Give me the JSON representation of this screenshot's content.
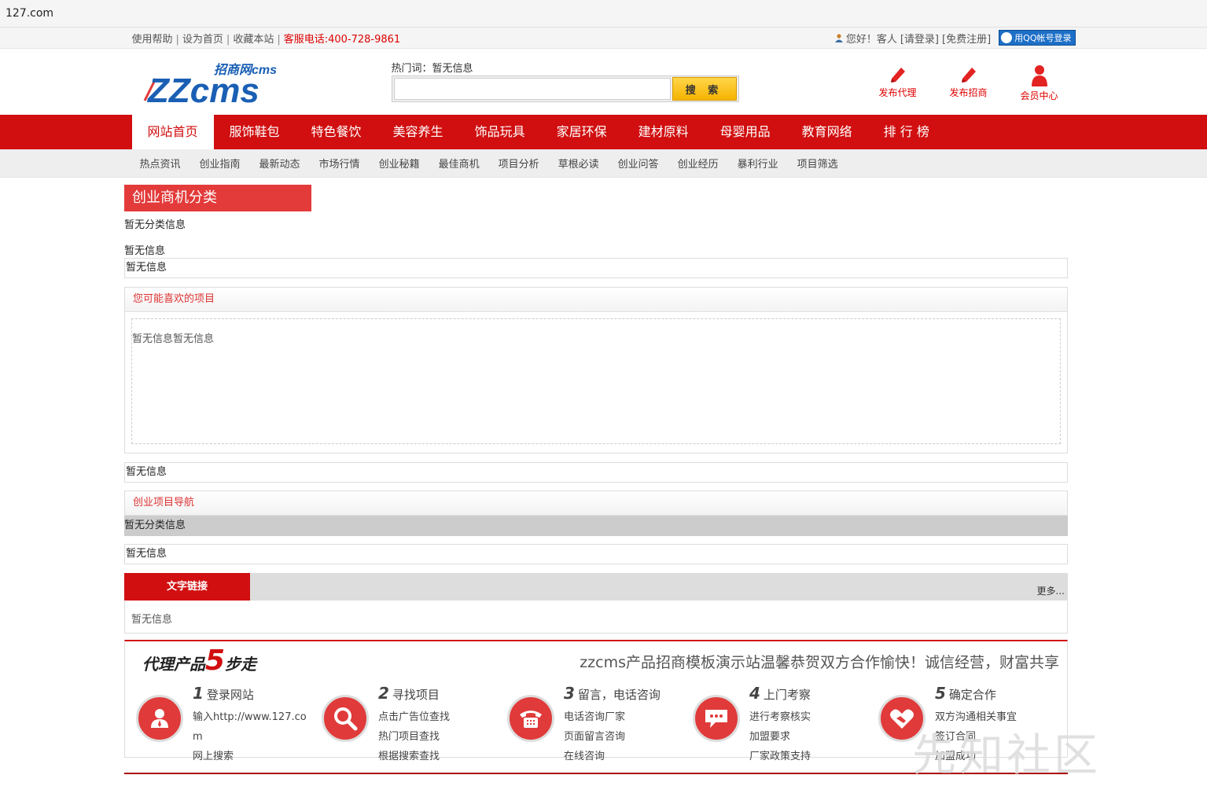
{
  "browser": {
    "url": "127.com"
  },
  "topbar": {
    "links": [
      "使用帮助",
      "设为首页",
      "收藏本站"
    ],
    "tel": "客服电话:400-728-9861",
    "greeting": "您好！客人",
    "login": "[请登录]",
    "register": "[免费注册]",
    "qq_login": "用QQ帐号登录"
  },
  "header": {
    "logo_top": "招商网cms",
    "logo_main": "ZZcms",
    "hot_words": "热门词：暂无信息",
    "search_button": "搜 索",
    "quick_links": [
      {
        "label": "发布代理",
        "icon": "pen-icon"
      },
      {
        "label": "发布招商",
        "icon": "pen-icon"
      },
      {
        "label": "会员中心",
        "icon": "user-icon"
      }
    ]
  },
  "nav": [
    "网站首页",
    "服饰鞋包",
    "特色餐饮",
    "美容养生",
    "饰品玩具",
    "家居环保",
    "建材原料",
    "母婴用品",
    "教育网络",
    "排 行 榜"
  ],
  "subnav": [
    "热点资讯",
    "创业指南",
    "最新动态",
    "市场行情",
    "创业秘籍",
    "最佳商机",
    "项目分析",
    "草根必读",
    "创业问答",
    "创业经历",
    "暴利行业",
    "项目筛选"
  ],
  "main": {
    "category_title": "创业商机分类",
    "no_category": "暂无分类信息",
    "no_info_1": "暂无信息",
    "no_info_2": "暂无信息",
    "like_title": "您可能喜欢的项目",
    "like_body": "暂无信息暂无信息",
    "no_info_3": "暂无信息",
    "nav_title": "创业项目导航",
    "nav_no_category": "暂无分类信息",
    "no_info_4": "暂无信息",
    "links_title": "文字链接",
    "links_more": "更多...",
    "links_body": "暂无信息"
  },
  "steps": {
    "title_a": "代理产品",
    "title_num": "5",
    "title_b": "步走",
    "slogan": "zzcms产品招商模板演示站温馨恭贺双方合作愉快！诚信经营，财富共享",
    "items": [
      {
        "n": "1",
        "title": "登录网站",
        "lines": [
          "输入http://www.127.co",
          "m",
          "网上搜索"
        ],
        "icon": "person-icon"
      },
      {
        "n": "2",
        "title": "寻找项目",
        "lines": [
          "点击广告位查找",
          "热门项目查找",
          "根据搜索查找"
        ],
        "icon": "magnifier-icon"
      },
      {
        "n": "3",
        "title": "留言，电话咨询",
        "lines": [
          "电话咨询厂家",
          "页面留言咨询",
          "在线咨询"
        ],
        "icon": "phone-icon"
      },
      {
        "n": "4",
        "title": "上门考察",
        "lines": [
          "进行考察核实",
          "加盟要求",
          "厂家政策支持"
        ],
        "icon": "chat-icon"
      },
      {
        "n": "5",
        "title": "确定合作",
        "lines": [
          "双方沟通相关事宜",
          "签订合同",
          "加盟成功"
        ],
        "icon": "handshake-icon"
      }
    ]
  },
  "watermark": "先知社区",
  "colors": {
    "brand_red": "#d10f10",
    "accent_red": "#e33a3a",
    "logo_blue": "#1a5fb4"
  }
}
